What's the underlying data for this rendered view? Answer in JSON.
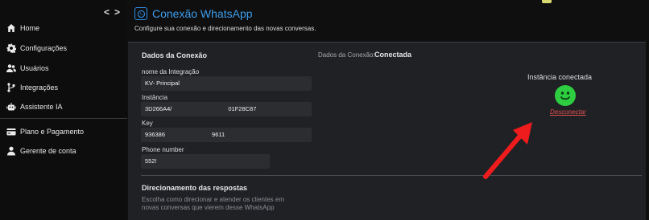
{
  "sidebar": {
    "toggle_left": "<",
    "toggle_right": ">",
    "items": [
      {
        "label": "Home",
        "icon": "home-icon"
      },
      {
        "label": "Configurações",
        "icon": "gear-icon"
      },
      {
        "label": "Usuários",
        "icon": "users-icon"
      },
      {
        "label": "Integrações",
        "icon": "integration-icon"
      },
      {
        "label": "Assistente IA",
        "icon": "robot-icon"
      },
      {
        "label": "Plano e Pagamento",
        "icon": "billing-icon"
      },
      {
        "label": "Gerente de conta",
        "icon": "account-manager-icon"
      }
    ]
  },
  "header": {
    "title": "Conexão WhatsApp",
    "subtitle": "Configure sua conexão e direcionamento das novas conversas.",
    "accent_color": "#3d9be9"
  },
  "connection": {
    "section_title": "Dados da Conexão",
    "status_label": "Dados da Conexão:",
    "status_value": "Conectada",
    "fields": {
      "integration_name": {
        "label": "nome da Integração",
        "value": "KV- Principal"
      },
      "instance": {
        "label": "Instância",
        "value_start": "3D266A4/",
        "value_end": "01F28C87"
      },
      "key": {
        "label": "Key",
        "value_start": "936386",
        "value_end": "9611"
      },
      "phone": {
        "label": "Phone number",
        "value": "552!"
      }
    }
  },
  "instance_status": {
    "title": "Instância conectada",
    "disconnect_label": "Desconectar",
    "status_color": "#2ecc40"
  },
  "routing": {
    "section_title": "Direcionamento das respostas",
    "description": "Escolha como direcionar e atender os clientes em novas conversas que vierem desse WhatsApp"
  }
}
